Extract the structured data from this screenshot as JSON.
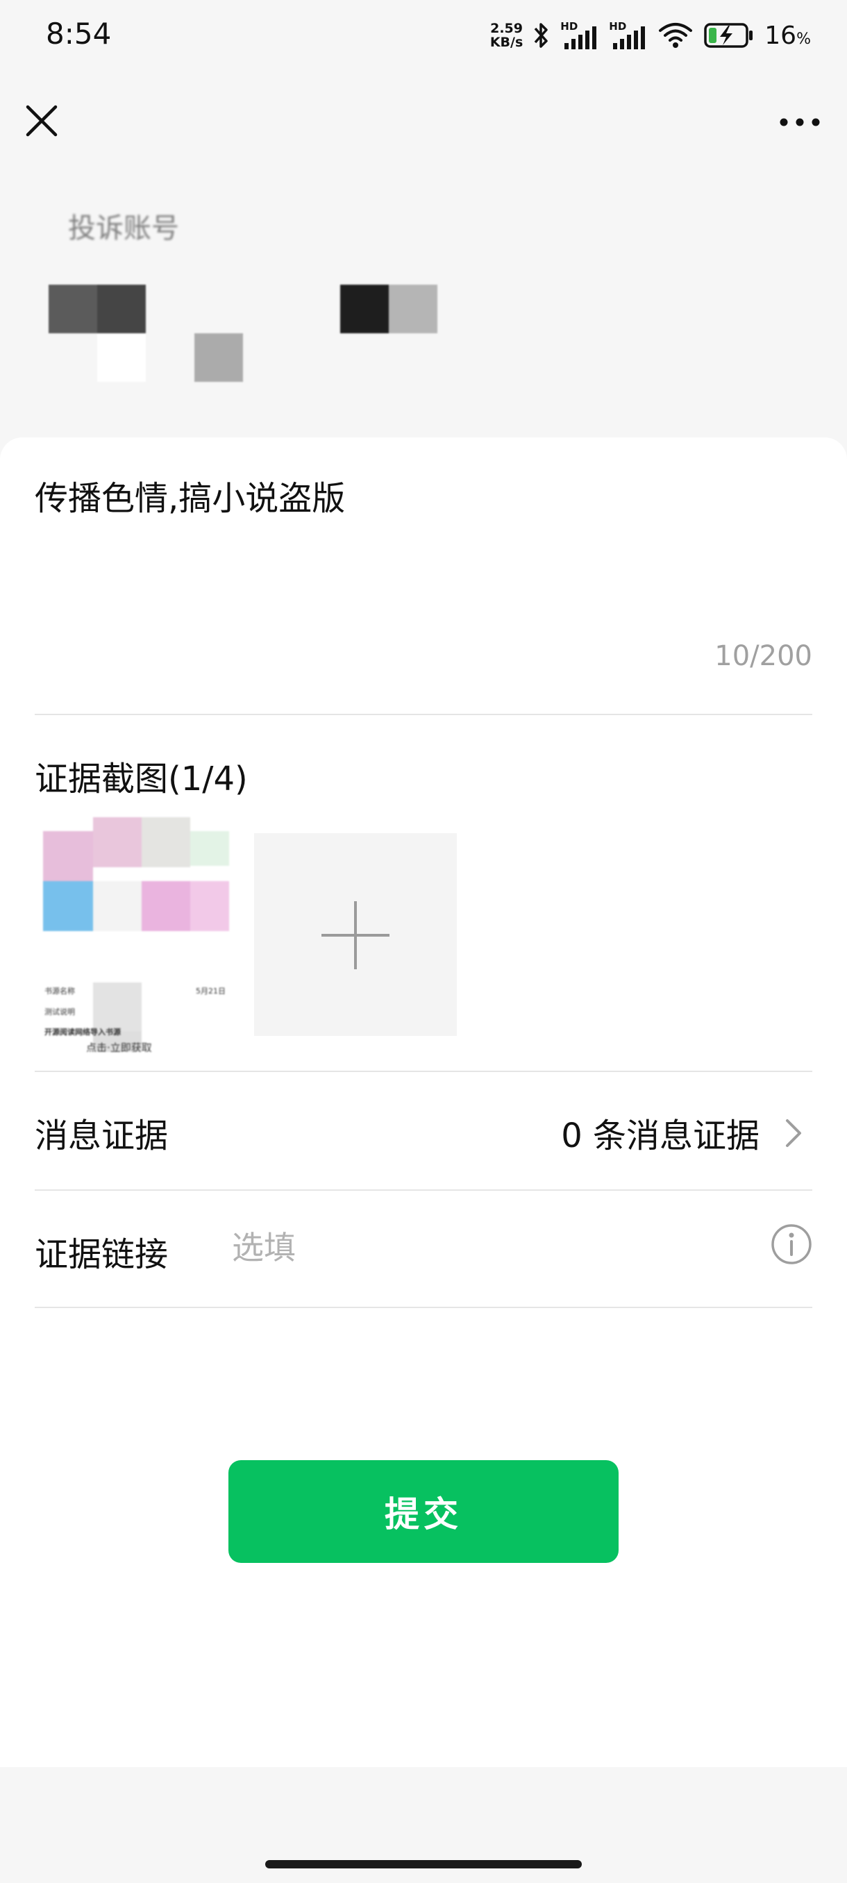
{
  "status_bar": {
    "time": "8:54",
    "net_speed_value": "2.59",
    "net_speed_unit": "KB/s",
    "bluetooth_icon": "bluetooth-icon",
    "signal_1_label": "HD",
    "signal_2_label": "HD",
    "wifi_icon": "wifi-icon",
    "battery_icon": "battery-charging-icon",
    "battery_percent": "16",
    "battery_unit": "%"
  },
  "nav": {
    "close_icon": "close-icon",
    "more_icon": "more-icon"
  },
  "account": {
    "label": "投诉账号"
  },
  "description": {
    "text": "传播色情,搞小说盗版",
    "counter": "10/200"
  },
  "screenshots": {
    "title": "证据截图(1/4)",
    "thumb_texts": [
      "书源名称",
      "5月21日",
      "测试说明",
      "开源阅读网络导入书源",
      "点击·立即获取"
    ],
    "add_icon": "plus-icon"
  },
  "message_evidence": {
    "label": "消息证据",
    "value": "0 条消息证据",
    "chevron_icon": "chevron-right-icon"
  },
  "evidence_link": {
    "label": "证据链接",
    "placeholder": "选填",
    "value": "",
    "info_icon": "info-icon"
  },
  "submit": {
    "label": "提交"
  },
  "colors": {
    "primary": "#07c160",
    "background": "#f6f6f6",
    "placeholder": "#b2b2b2"
  }
}
